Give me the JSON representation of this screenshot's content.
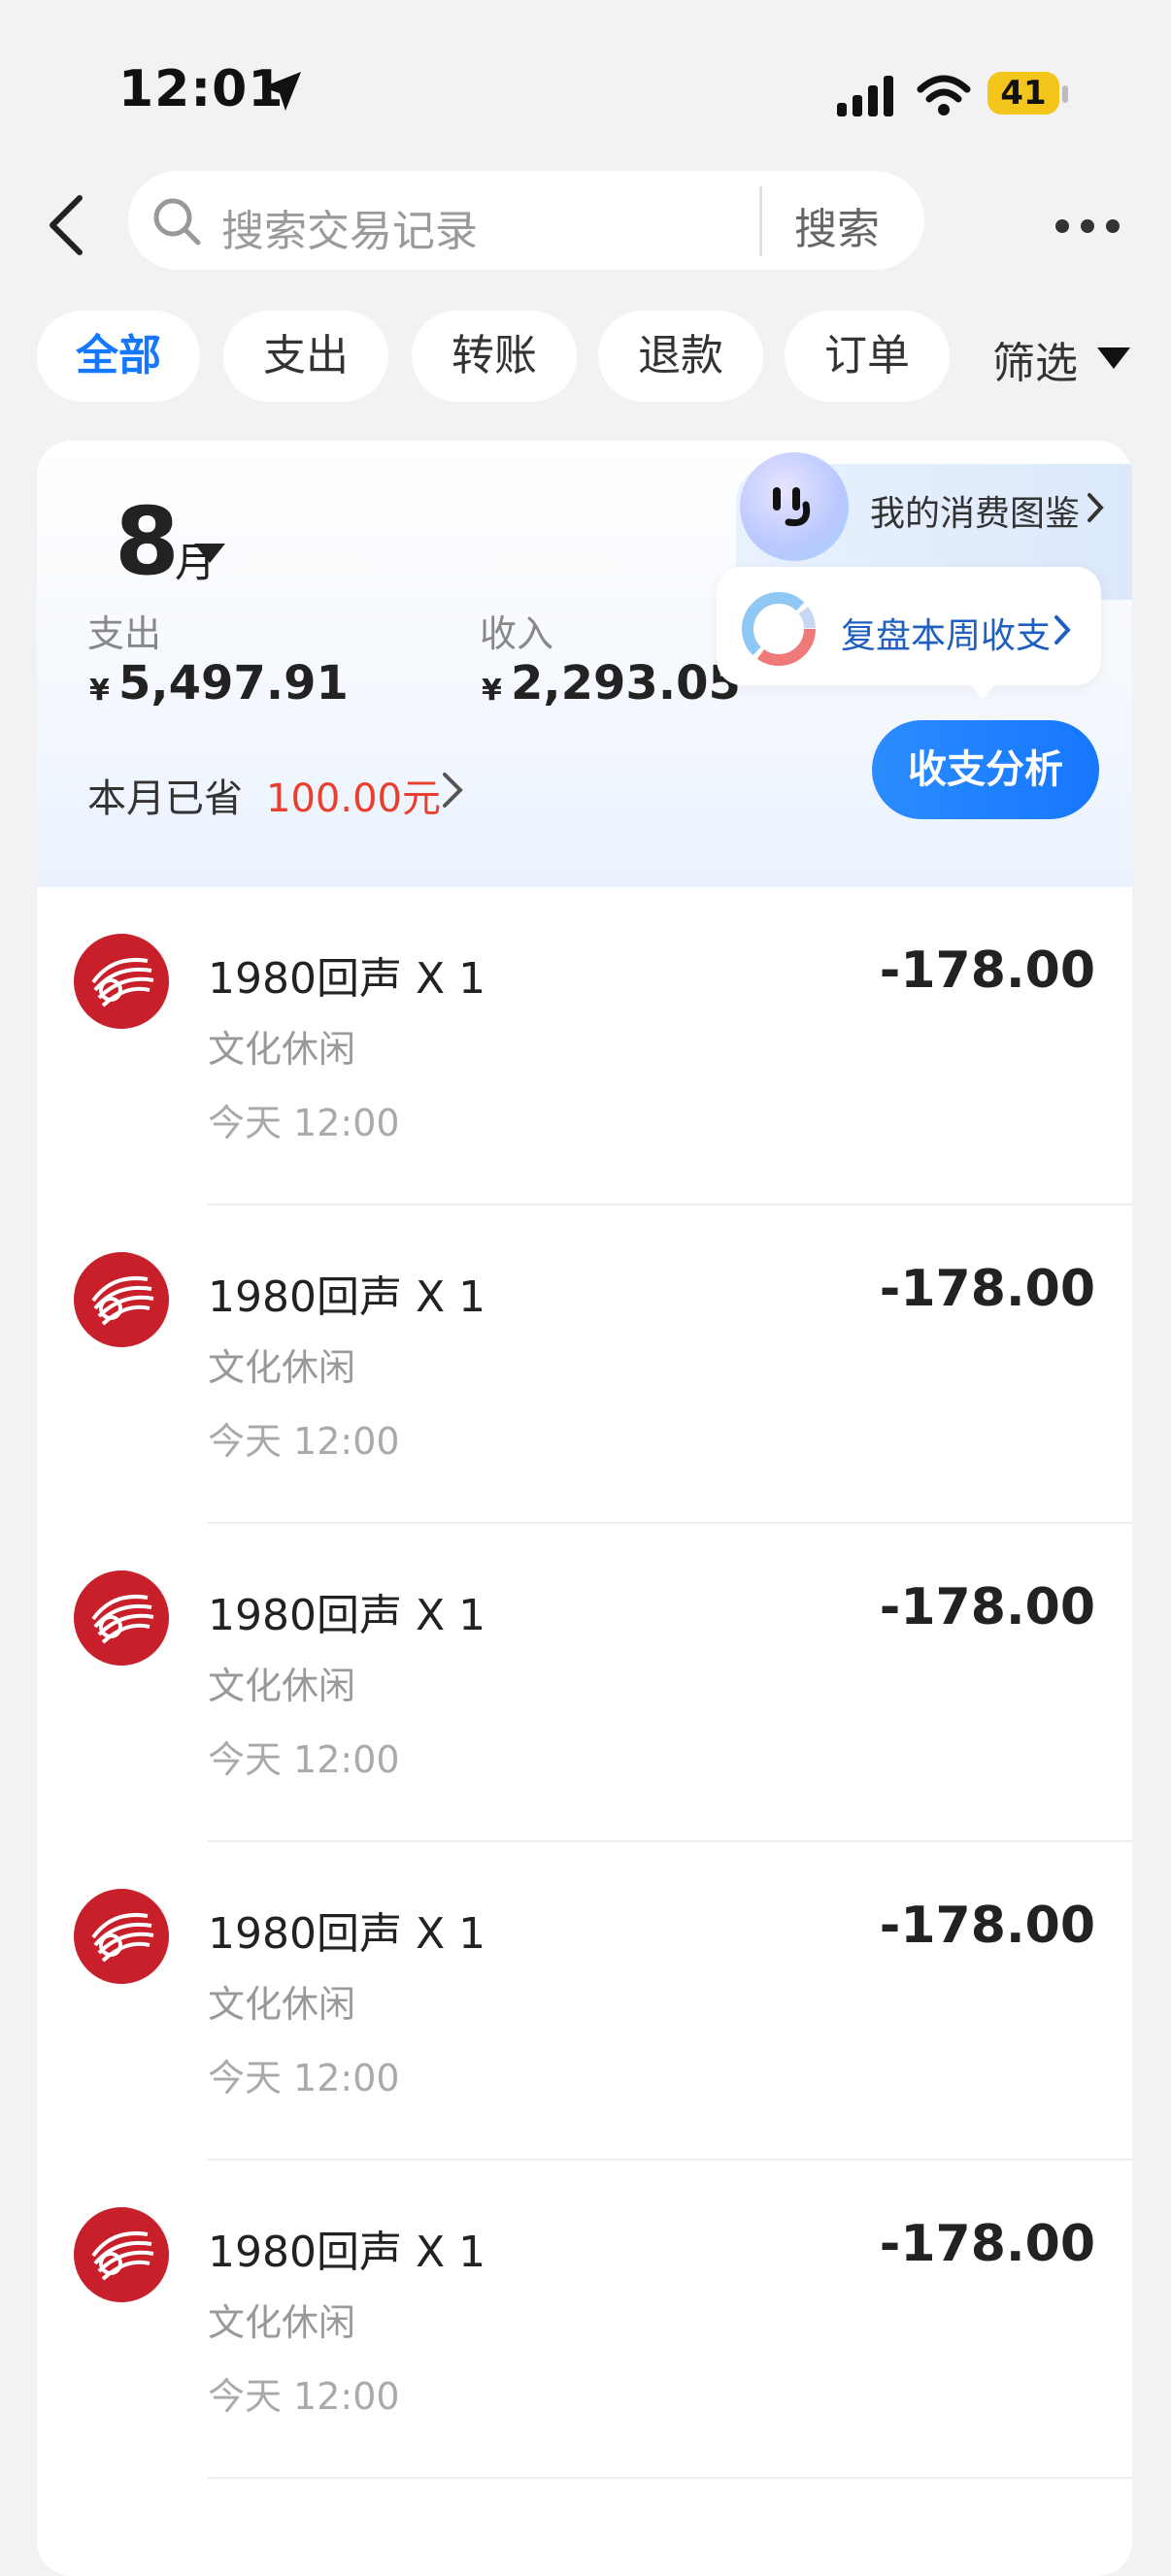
{
  "status_bar": {
    "time": "12:01",
    "battery": "41"
  },
  "header": {
    "search_placeholder": "搜索交易记录",
    "search_button": "搜索"
  },
  "tabs": [
    {
      "label": "全部",
      "active": true
    },
    {
      "label": "支出",
      "active": false
    },
    {
      "label": "转账",
      "active": false
    },
    {
      "label": "退款",
      "active": false
    },
    {
      "label": "订单",
      "active": false
    }
  ],
  "filter_label": "筛选",
  "summary": {
    "month": "8",
    "month_unit": "月",
    "expense_label": "支出",
    "expense_currency": "¥",
    "expense_value": "5,497.91",
    "income_label": "收入",
    "income_currency": "¥",
    "income_value": "2,293.05",
    "saved_label": "本月已省",
    "saved_value": "100.00元",
    "gallery_link": "我的消费图鉴",
    "review_link": "复盘本周收支",
    "analysis_button": "收支分析"
  },
  "transactions": [
    {
      "title": "1980回声 X 1",
      "category": "文化休闲",
      "time": "今天 12:00",
      "amount": "-178.00"
    },
    {
      "title": "1980回声 X 1",
      "category": "文化休闲",
      "time": "今天 12:00",
      "amount": "-178.00"
    },
    {
      "title": "1980回声 X 1",
      "category": "文化休闲",
      "time": "今天 12:00",
      "amount": "-178.00"
    },
    {
      "title": "1980回声 X 1",
      "category": "文化休闲",
      "time": "今天 12:00",
      "amount": "-178.00"
    },
    {
      "title": "1980回声 X 1",
      "category": "文化休闲",
      "time": "今天 12:00",
      "amount": "-178.00"
    }
  ],
  "colors": {
    "accent": "#1677ff",
    "saved": "#e8402f",
    "logo": "#c8202a"
  }
}
